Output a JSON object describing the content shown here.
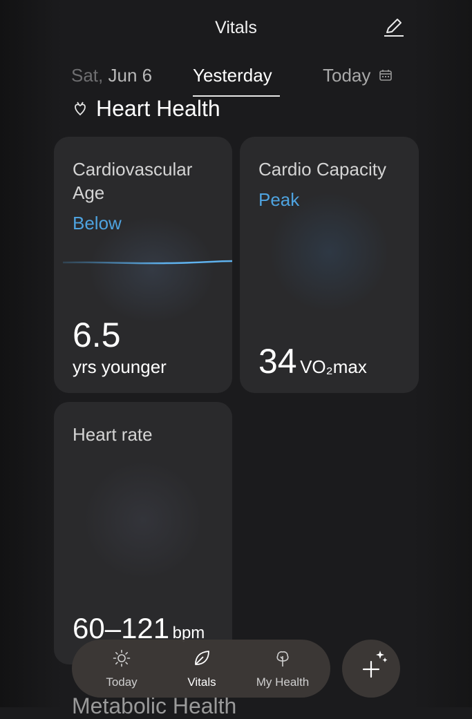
{
  "header": {
    "title": "Vitals"
  },
  "date_tabs": {
    "previous_weekday": "Sat,",
    "previous_date": "Jun 6",
    "active": "Yesterday",
    "today": "Today"
  },
  "section": {
    "title": "Heart Health"
  },
  "cards": {
    "cardiovascular_age": {
      "title": "Cardiovascular Age",
      "status": "Below",
      "value": "6.5",
      "unit": "yrs younger"
    },
    "cardio_capacity": {
      "title": "Cardio Capacity",
      "status": "Peak",
      "value": "34",
      "unit": "VO₂max"
    },
    "heart_rate": {
      "title": "Heart rate",
      "value": "60–121",
      "unit": "bpm"
    }
  },
  "next_section": {
    "title": "Metabolic Health"
  },
  "nav": {
    "items": [
      {
        "label": "Today",
        "icon": "sun-icon"
      },
      {
        "label": "Vitals",
        "icon": "leaf-icon",
        "active": true
      },
      {
        "label": "My Health",
        "icon": "tree-icon"
      }
    ],
    "fab_icon": "add-sparkle-icon"
  },
  "colors": {
    "accent": "#4ea3e0",
    "background": "#1b1b1d",
    "card": "#2a2a2c"
  }
}
